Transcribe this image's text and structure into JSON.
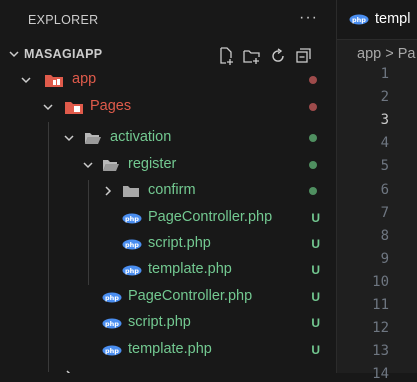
{
  "explorer": {
    "title": "EXPLORER",
    "more_label": "···",
    "root": "MASAGIAPP"
  },
  "tree": {
    "app": "app",
    "pages": "Pages",
    "activation": "activation",
    "register": "register",
    "confirm": "confirm",
    "reg_pagecontroller": "PageController.php",
    "reg_script": "script.php",
    "reg_template": "template.php",
    "act_pagecontroller": "PageController.php",
    "act_script": "script.php",
    "act_template": "template.php",
    "untracked_badge": "U"
  },
  "editor": {
    "tab_label": "templ",
    "breadcrumb": "app > Pa",
    "line_numbers": [
      "1",
      "2",
      "3",
      "4",
      "5",
      "6",
      "7",
      "8",
      "9",
      "10",
      "11",
      "12",
      "13",
      "14"
    ],
    "active_line": "3"
  },
  "colors": {
    "modified_dot": "#9e4b4b",
    "untracked_green": "#73c991",
    "folder_red": "#e05b4b",
    "php_blue": "#4a8ef0"
  },
  "icons": {
    "new_file": "new-file-icon",
    "new_folder": "new-folder-icon",
    "refresh": "refresh-icon",
    "collapse": "collapse-all-icon",
    "php": "php-icon"
  }
}
